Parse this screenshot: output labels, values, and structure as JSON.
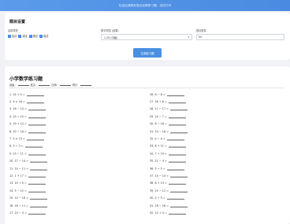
{
  "banner": {
    "text": "包含加减乘除混合运算练习题，支持打印"
  },
  "settings": {
    "title": "题目设置",
    "ops_label": "运算类型",
    "ops": [
      "加法",
      "减法",
      "乘法",
      "除法"
    ],
    "range_label": "数字范围 (结果)",
    "range_value": "1-20 (中级)",
    "qty_label": "题目数量",
    "qty_value": "50",
    "generate_label": "生成练习题"
  },
  "paper": {
    "title": "小学数学练习题",
    "fields": [
      "班级",
      "姓名",
      "日期",
      "得分"
    ],
    "left": [
      "1. 14 + 5 =",
      "2. 9 × 16 =",
      "3. 16 − 13 =",
      "4. 15 ÷ 15 =",
      "5. 19 + 13 =",
      "6. 20 − 18 =",
      "7. 3 × 13 =",
      "8. 3 ÷ 3 =",
      "9. 13 − 11 =",
      "10. 17 − 14 =",
      "11. 14 − 11 =",
      "12. 1 + 17 =",
      "13. 10 ÷ 5 =",
      "14. 5 − 12 =",
      "15. 10 − 16 =",
      "16. 16 ÷ 11 =",
      "17. 14 − 3 ="
    ],
    "right": [
      "26. 8 − 8 =",
      "27. 16 ÷ 8 =",
      "28. 17 − 17 =",
      "29. 14 − 7 =",
      "30. 8 − 16 =",
      "31. 10 − 16 =",
      "32. 4 − 4 =",
      "33. 8 + 11 =",
      "34. 7 + 19 =",
      "35. 11 − 4 =",
      "36. 5 ÷ 5 =",
      "37. 14 − 14 =",
      "38. 8 + 13 =",
      "39. 15 − 12 =",
      "40. 2 ÷ 5 =",
      "41. 18 − 18 =",
      "42. 12 + 4 ="
    ]
  }
}
